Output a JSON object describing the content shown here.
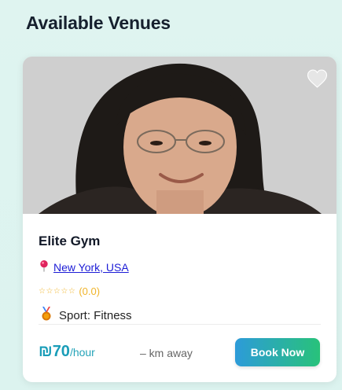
{
  "page": {
    "title": "Available Venues"
  },
  "venue": {
    "name": "Elite Gym",
    "location": "New York, USA",
    "rating_stars": "☆☆☆☆☆",
    "rating_text": "(0.0)",
    "sport_label": "Sport: Fitness",
    "price_currency": "₪",
    "price_amount": "70",
    "price_unit": "/hour",
    "distance": "– km away",
    "book_label": "Book Now"
  },
  "colors": {
    "accent_teal": "#1a9db8",
    "link": "#1d1dd6",
    "star": "#f0b429",
    "button_gradient_start": "#2d9bd9",
    "button_gradient_end": "#28c27a"
  },
  "icons": {
    "favorite": "heart-icon",
    "location": "map-pin-icon",
    "sport": "medal-icon"
  }
}
